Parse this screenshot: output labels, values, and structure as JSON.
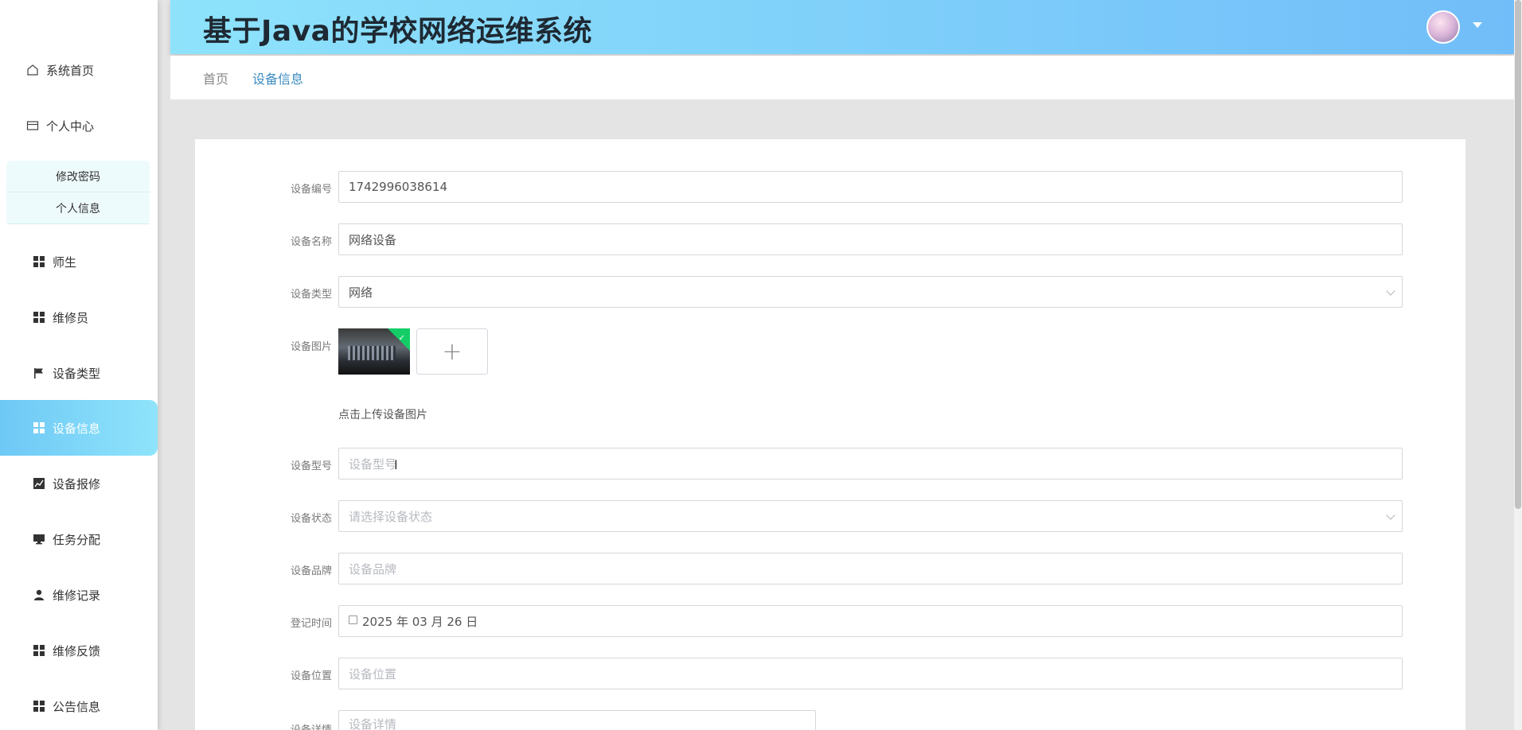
{
  "app": {
    "title": "基于Java的学校网络运维系统"
  },
  "sidebar": {
    "items": [
      {
        "label": "系统首页",
        "icon": "home-icon"
      },
      {
        "label": "个人中心",
        "icon": "wallet-icon"
      },
      {
        "label": "师生",
        "icon": "grid-icon"
      },
      {
        "label": "维修员",
        "icon": "grid-icon"
      },
      {
        "label": "设备类型",
        "icon": "flag-icon"
      },
      {
        "label": "设备信息",
        "icon": "grid-icon",
        "active": true
      },
      {
        "label": "设备报修",
        "icon": "chart-icon"
      },
      {
        "label": "任务分配",
        "icon": "monitor-icon"
      },
      {
        "label": "维修记录",
        "icon": "user-icon"
      },
      {
        "label": "维修反馈",
        "icon": "grid-icon"
      },
      {
        "label": "公告信息",
        "icon": "grid-icon"
      }
    ],
    "submenu": [
      {
        "label": "修改密码"
      },
      {
        "label": "个人信息"
      }
    ]
  },
  "breadcrumb": {
    "home": "首页",
    "current": "设备信息"
  },
  "form": {
    "device_no": {
      "label": "设备编号",
      "value": "1742996038614"
    },
    "device_name": {
      "label": "设备名称",
      "value": "网络设备"
    },
    "device_type": {
      "label": "设备类型",
      "value": "网络"
    },
    "device_image": {
      "label": "设备图片",
      "hint": "点击上传设备图片",
      "add_glyph": "+"
    },
    "device_model": {
      "label": "设备型号",
      "placeholder": "设备型号"
    },
    "device_status": {
      "label": "设备状态",
      "placeholder": "请选择设备状态"
    },
    "device_brand": {
      "label": "设备品牌",
      "placeholder": "设备品牌"
    },
    "register_time": {
      "label": "登记时间",
      "value": "2025 年 03 月 26 日"
    },
    "device_location": {
      "label": "设备位置",
      "placeholder": "设备位置"
    },
    "device_detail": {
      "label": "设备详情",
      "placeholder": "设备详情"
    }
  },
  "colors": {
    "header_gradient_start": "#8ee3fb",
    "header_gradient_end": "#71bdf9",
    "active_nav": "#6ec8f5",
    "breadcrumb_active": "#3d8cc1",
    "upload_success": "#13ce66"
  }
}
